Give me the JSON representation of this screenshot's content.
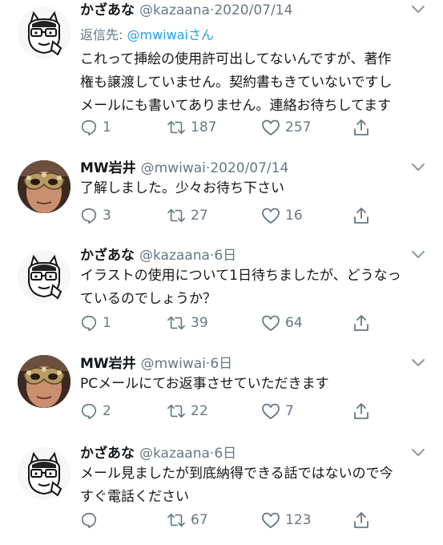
{
  "tweets": [
    {
      "name": "かざあな",
      "handle": "@kazaana",
      "separator": "·",
      "date": "2020/07/14",
      "reply_prefix": "返信先: ",
      "reply_mention": "@mwiwai",
      "reply_suffix": "さん",
      "text": "これって挿絵の使用許可出してないんですが、著作\n権も譲渡していません。契約書もきていないですし\nメールにも書いてありません。連絡お待ちしてます",
      "replies": "1",
      "retweets": "187",
      "likes": "257",
      "avatar": "cat-character-avatar"
    },
    {
      "name": "MW岩井",
      "handle": "@mwiwai",
      "separator": "·",
      "date": "2020/07/14",
      "text": "了解しました。少々お待ち下さい",
      "replies": "3",
      "retweets": "27",
      "likes": "16",
      "avatar": "masked-person-photo"
    },
    {
      "name": "かざあな",
      "handle": "@kazaana",
      "separator": "·",
      "date": "6日",
      "text": "イラストの使用について1日待ちましたが、どうなっ\nているのでしょうか？",
      "replies": "1",
      "retweets": "39",
      "likes": "64",
      "avatar": "cat-character-avatar"
    },
    {
      "name": "MW岩井",
      "handle": "@mwiwai",
      "separator": "·",
      "date": "6日",
      "text": "PCメールにてお返事させていただきます",
      "replies": "2",
      "retweets": "22",
      "likes": "7",
      "avatar": "masked-person-photo"
    },
    {
      "name": "かざあな",
      "handle": "@kazaana",
      "separator": "·",
      "date": "6日",
      "text": "メール見ましたが到底納得できる話ではないので今\nすぐ電話ください",
      "replies": "",
      "retweets": "67",
      "likes": "123",
      "avatar": "cat-character-avatar"
    }
  ],
  "colors": {
    "text": "#14171a",
    "secondary": "#657786",
    "link": "#1da1f2"
  }
}
